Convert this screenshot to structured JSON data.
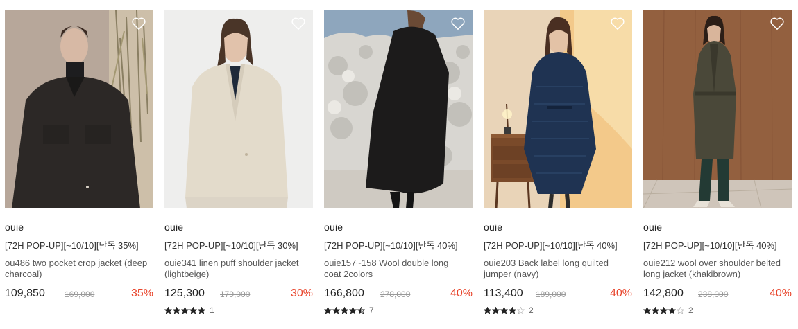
{
  "products": [
    {
      "brand": "ouie",
      "promo": "[72H POP-UP][~10/10][단독 35%]",
      "name": "ou486 two pocket crop jacket (deep charcoal)",
      "price": "109,850",
      "original_price": "169,000",
      "discount": "35%",
      "rating": null,
      "review_count": null
    },
    {
      "brand": "ouie",
      "promo": "[72H POP-UP][~10/10][단독 30%]",
      "name": "ouie341 linen puff shoulder jacket (lightbeige)",
      "price": "125,300",
      "original_price": "179,000",
      "discount": "30%",
      "rating": 5,
      "review_count": "1"
    },
    {
      "brand": "ouie",
      "promo": "[72H POP-UP][~10/10][단독 40%]",
      "name": "ouie157~158 Wool double long coat 2colors",
      "price": "166,800",
      "original_price": "278,000",
      "discount": "40%",
      "rating": 4.5,
      "review_count": "7"
    },
    {
      "brand": "ouie",
      "promo": "[72H POP-UP][~10/10][단독 40%]",
      "name": "ouie203 Back label long quilted jumper (navy)",
      "price": "113,400",
      "original_price": "189,000",
      "discount": "40%",
      "rating": 4,
      "review_count": "2"
    },
    {
      "brand": "ouie",
      "promo": "[72H POP-UP][~10/10][단독 40%]",
      "name": "ouie212 wool over shoulder belted long jacket (khakibrown)",
      "price": "142,800",
      "original_price": "238,000",
      "discount": "40%",
      "rating": 4,
      "review_count": "2"
    }
  ],
  "colors": {
    "discount": "#e8442b",
    "star_filled": "#222222",
    "star_empty": "#bbbbbb"
  }
}
